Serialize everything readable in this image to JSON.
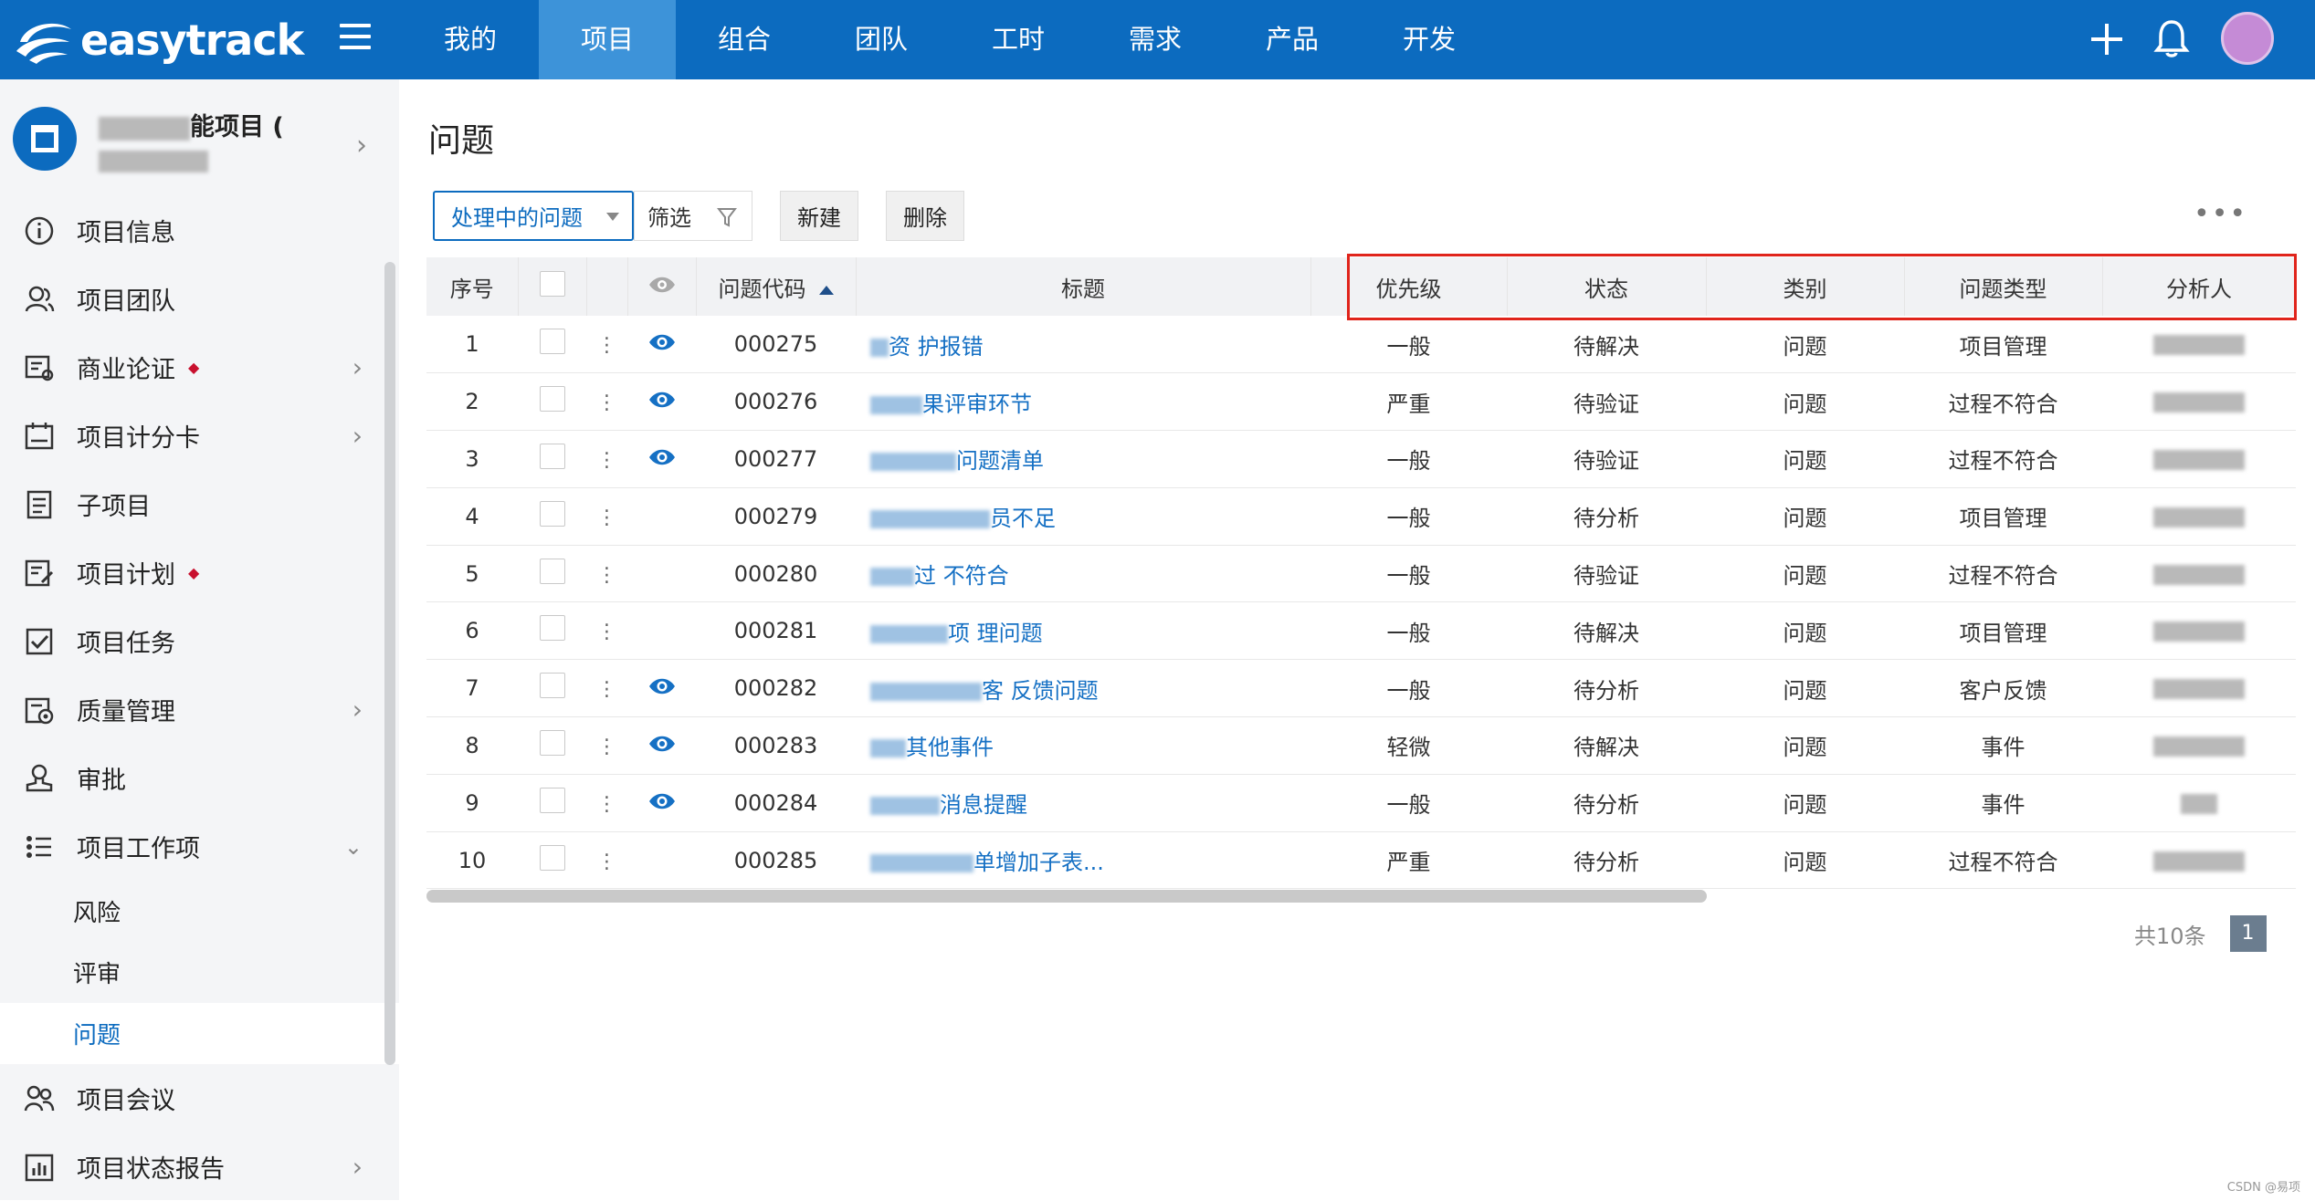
{
  "app": {
    "logo_text": "easytrack"
  },
  "nav": {
    "items": [
      "我的",
      "项目",
      "组合",
      "团队",
      "工时",
      "需求",
      "产品",
      "开发"
    ],
    "active_index": 1
  },
  "sidebar": {
    "project_name": "能项目 (",
    "items": [
      {
        "label": "项目信息",
        "icon": "info-icon",
        "chevron": false,
        "dot": false
      },
      {
        "label": "项目团队",
        "icon": "team-icon",
        "chevron": false,
        "dot": false
      },
      {
        "label": "商业论证",
        "icon": "business-case-icon",
        "chevron": true,
        "dot": true
      },
      {
        "label": "项目计分卡",
        "icon": "scorecard-icon",
        "chevron": true,
        "dot": false
      },
      {
        "label": "子项目",
        "icon": "subproject-icon",
        "chevron": false,
        "dot": false
      },
      {
        "label": "项目计划",
        "icon": "plan-icon",
        "chevron": false,
        "dot": true
      },
      {
        "label": "项目任务",
        "icon": "task-icon",
        "chevron": false,
        "dot": false
      },
      {
        "label": "质量管理",
        "icon": "quality-icon",
        "chevron": true,
        "dot": false
      },
      {
        "label": "审批",
        "icon": "approval-icon",
        "chevron": false,
        "dot": false
      },
      {
        "label": "项目工作项",
        "icon": "work-items-icon",
        "chevron": true,
        "expanded": true,
        "dot": false
      }
    ],
    "sub_items": [
      {
        "label": "风险",
        "active": false
      },
      {
        "label": "评审",
        "active": false
      },
      {
        "label": "问题",
        "active": true
      }
    ],
    "items_after": [
      {
        "label": "项目会议",
        "icon": "meeting-icon",
        "chevron": false
      },
      {
        "label": "项目状态报告",
        "icon": "report-icon",
        "chevron": true
      }
    ]
  },
  "page": {
    "title": "问题",
    "filter_select": "处理中的问题",
    "filter_label": "筛选",
    "new_button": "新建",
    "delete_button": "删除",
    "more": "•••"
  },
  "table": {
    "columns": [
      "序号",
      "",
      "",
      "",
      "问题代码",
      "标题",
      "优先级",
      "状态",
      "类别",
      "问题类型",
      "分析人"
    ],
    "rows": [
      {
        "no": "1",
        "eye": true,
        "code": "000275",
        "title": "资 护报错",
        "priority": "一般",
        "status": "待解决",
        "category": "问题",
        "type": "项目管理"
      },
      {
        "no": "2",
        "eye": true,
        "code": "000276",
        "title": "果评审环节",
        "priority": "严重",
        "status": "待验证",
        "category": "问题",
        "type": "过程不符合"
      },
      {
        "no": "3",
        "eye": true,
        "code": "000277",
        "title": "问题清单",
        "priority": "一般",
        "status": "待验证",
        "category": "问题",
        "type": "过程不符合"
      },
      {
        "no": "4",
        "eye": false,
        "code": "000279",
        "title": "员不足",
        "priority": "一般",
        "status": "待分析",
        "category": "问题",
        "type": "项目管理"
      },
      {
        "no": "5",
        "eye": false,
        "code": "000280",
        "title": "过 不符合",
        "priority": "一般",
        "status": "待验证",
        "category": "问题",
        "type": "过程不符合"
      },
      {
        "no": "6",
        "eye": false,
        "code": "000281",
        "title": "项 理问题",
        "priority": "一般",
        "status": "待解决",
        "category": "问题",
        "type": "项目管理"
      },
      {
        "no": "7",
        "eye": true,
        "code": "000282",
        "title": "客 反馈问题",
        "priority": "一般",
        "status": "待分析",
        "category": "问题",
        "type": "客户反馈"
      },
      {
        "no": "8",
        "eye": true,
        "code": "000283",
        "title": "其他事件",
        "priority": "轻微",
        "status": "待解决",
        "category": "问题",
        "type": "事件"
      },
      {
        "no": "9",
        "eye": true,
        "code": "000284",
        "title": "消息提醒",
        "priority": "一般",
        "status": "待分析",
        "category": "问题",
        "type": "事件"
      },
      {
        "no": "10",
        "eye": false,
        "code": "000285",
        "title": "单增加子表...",
        "priority": "严重",
        "status": "待分析",
        "category": "问题",
        "type": "过程不符合"
      }
    ]
  },
  "pager": {
    "total": "共10条",
    "current": "1"
  },
  "watermark": "CSDN @易项",
  "colors": {
    "brand": "#0c6bbf",
    "nav_active": "#3d93d9",
    "highlight_box": "#e0241b",
    "link": "#1570c4"
  }
}
